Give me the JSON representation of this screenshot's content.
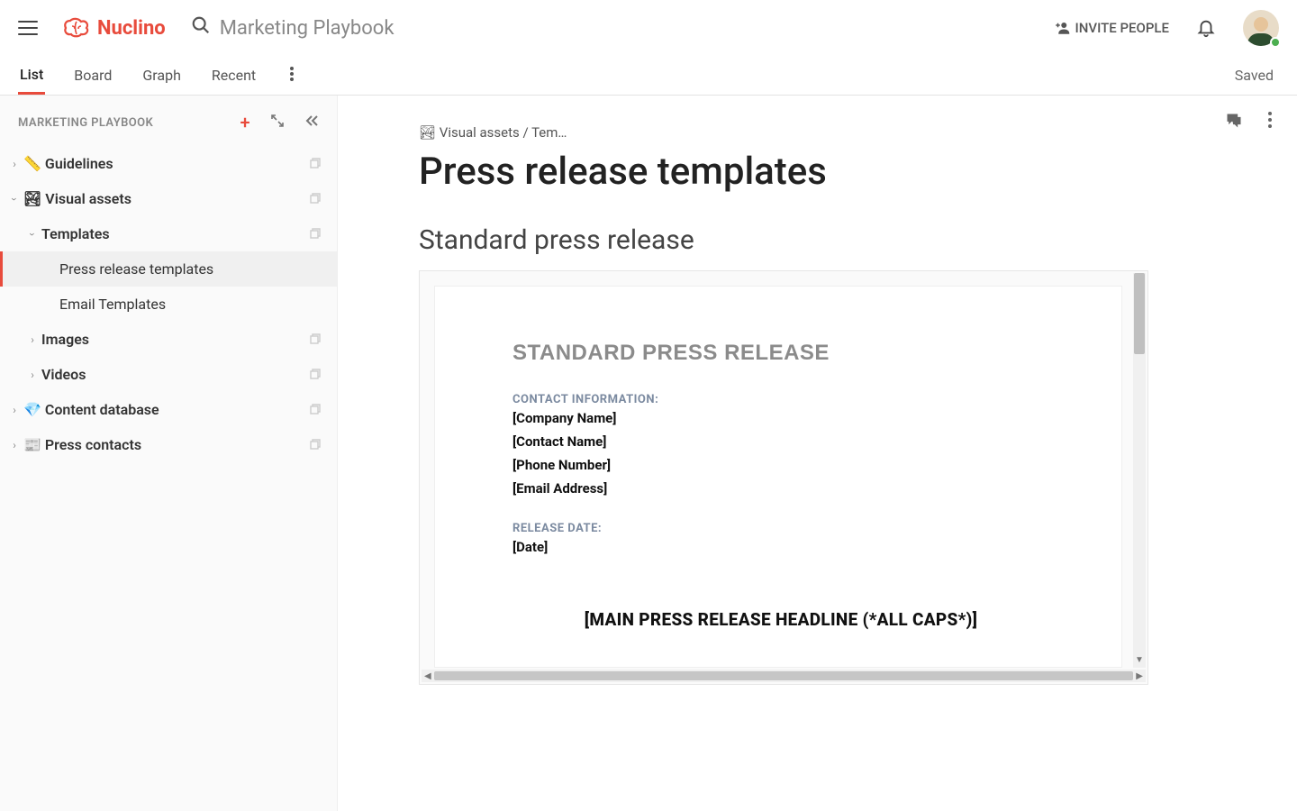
{
  "brand": "Nuclino",
  "search_placeholder": "Marketing Playbook",
  "invite_label": "INVITE PEOPLE",
  "tabs": [
    "List",
    "Board",
    "Graph",
    "Recent"
  ],
  "active_tab": 0,
  "saved_label": "Saved",
  "sidebar": {
    "title": "MARKETING PLAYBOOK",
    "items": [
      {
        "label": "Guidelines",
        "icon": "📏",
        "depth": 0,
        "expanded": false,
        "bold": true,
        "copy": true
      },
      {
        "label": "Visual assets",
        "icon": "🏞",
        "depth": 0,
        "expanded": true,
        "bold": true,
        "copy": true
      },
      {
        "label": "Templates",
        "icon": "",
        "depth": 1,
        "expanded": true,
        "bold": true,
        "copy": true
      },
      {
        "label": "Press release templates",
        "icon": "",
        "depth": 2,
        "leaf": true,
        "selected": true
      },
      {
        "label": "Email Templates",
        "icon": "",
        "depth": 2,
        "leaf": true
      },
      {
        "label": "Images",
        "icon": "",
        "depth": 1,
        "expanded": false,
        "bold": true,
        "copy": true
      },
      {
        "label": "Videos",
        "icon": "",
        "depth": 1,
        "expanded": false,
        "bold": true,
        "copy": true
      },
      {
        "label": "Content database",
        "icon": "💎",
        "depth": 0,
        "expanded": false,
        "bold": true,
        "copy": true
      },
      {
        "label": "Press contacts",
        "icon": "📰",
        "depth": 0,
        "expanded": false,
        "bold": true,
        "copy": true
      }
    ]
  },
  "breadcrumb": "🏞 Visual assets / Tem…",
  "page_title": "Press release templates",
  "section_title": "Standard press release",
  "document": {
    "heading": "STANDARD PRESS RELEASE",
    "contact_label": "CONTACT INFORMATION:",
    "contact_fields": [
      "[Company Name]",
      "[Contact Name]",
      "[Phone Number]",
      "[Email Address]"
    ],
    "release_label": "RELEASE DATE:",
    "release_fields": [
      "[Date]"
    ],
    "headline": "[MAIN PRESS RELEASE HEADLINE (*ALL CAPS*)]"
  }
}
